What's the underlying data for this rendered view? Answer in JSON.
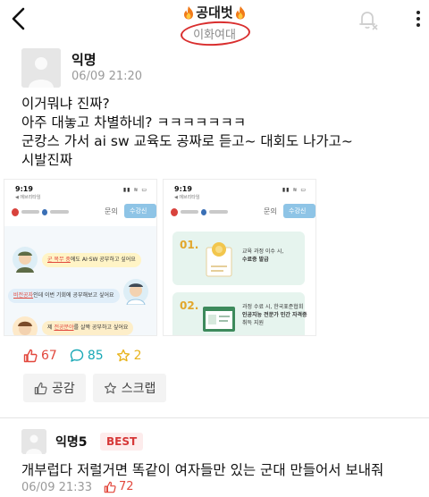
{
  "header": {
    "title": "공대벗",
    "subtitle": "이화여대",
    "annotation_color": "#d92e2e"
  },
  "post": {
    "author": "익명",
    "time": "06/09 21:20",
    "lines": [
      "이거뭐냐 진짜?",
      "아주 대놓고 차별하네? ㅋㅋㅋㅋㅋㅋㅋ",
      "군캉스 가서 ai sw 교육도 공짜로 듣고~ 대회도 나가고~",
      "시발진짜"
    ],
    "images": [
      {
        "status_time": "9:19",
        "status_sub": "◀ 에브리타임",
        "nav_label": "문의",
        "nav_button": "수강신청",
        "bubbles": [
          {
            "parts": [
              "군 복무 중",
              "에도 AI·SW 공부하고 싶어요"
            ]
          },
          {
            "parts": [
              "비전공자",
              "인데 이번 기회에 공부해보고 싶어요"
            ]
          },
          {
            "parts": [
              "제 ",
              "전공분야",
              "를 살짝 공부하고 싶어요"
            ]
          }
        ]
      },
      {
        "status_time": "9:19",
        "status_sub": "◀ 에브리타임",
        "nav_label": "문의",
        "nav_button": "수강신청",
        "cards": [
          {
            "num": "01.",
            "lines": [
              "교육 과정 이수 시,",
              "수료증 발급"
            ]
          },
          {
            "num": "02.",
            "lines": [
              "과정 수료 시, 한국표준협회",
              "인공지능 전문가 민간 자격증",
              "취득 지원"
            ]
          }
        ]
      }
    ],
    "stats": {
      "likes": "67",
      "comments": "85",
      "scraps": "2"
    },
    "actions": {
      "like_label": "공감",
      "scrap_label": "스크랩"
    }
  },
  "comment": {
    "author": "익명5",
    "badge": "BEST",
    "text": "개부럽다 저럴거면 똑같이 여자들만 있는 군대 만들어서 보내줘",
    "time": "06/09 21:33",
    "likes": "72"
  }
}
